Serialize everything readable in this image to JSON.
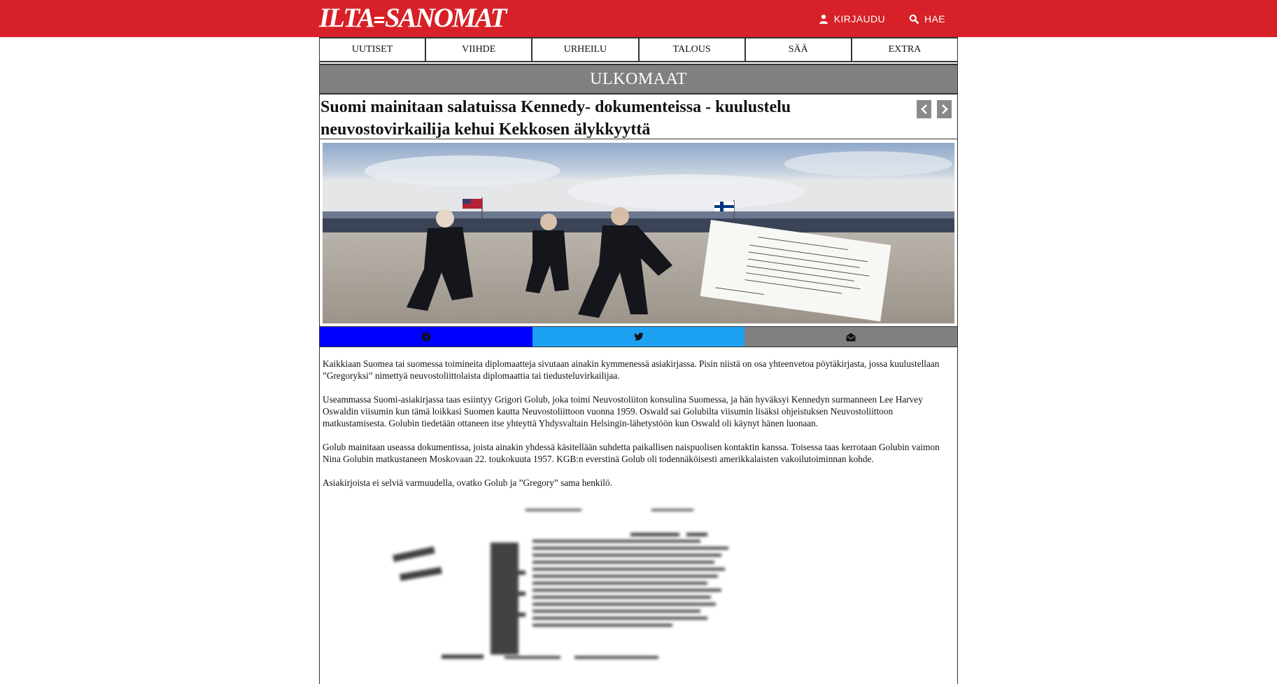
{
  "brand": {
    "logo_left": "ILTA",
    "logo_right": "SANOMAT",
    "accent": "#d72027"
  },
  "top_actions": {
    "login_label": "KIRJAUDU",
    "login_icon": "user-icon",
    "search_label": "HAE",
    "search_icon": "search-icon"
  },
  "nav": {
    "items": [
      "UUTISET",
      "VIIHDE",
      "URHEILU",
      "TALOUS",
      "SÄÄ",
      "EXTRA"
    ]
  },
  "section": {
    "title": "ULKOMAAT"
  },
  "article": {
    "headline": "Suomi mainitaan salatuissa Kennedy- dokumenteissa - kuulustelu neuvostovirkailija kehui Kekkosen älykkyyttä",
    "paragraphs": [
      "Kaikkiaan Suomea tai suomessa toimineita diplomaatteja sivutaan ainakin kymmenessä asiakirjassa. Pisin niistä on osa yhteenvetoa pöytäkirjasta, jossa kuulustellaan ”Gregoryksi” nimettyä neuvostoliittolaista diplomaattia tai tiedusteluvirkailijaa.",
      "Useammassa Suomi-asiakirjassa taas esiintyy Grigori Golub, joka toimi Neuvostoliiton konsulina Suomessa, ja hän hyväksyi Kennedyn surmanneen Lee Harvey Oswaldin viisumin kun tämä loikkasi Suomen kautta Neuvostoliittoon vuonna 1959. Oswald sai Golubilta viisumin lisäksi ohjeistuksen Neuvostoliittoon matkustamisesta. Golubin tiedetään ottaneen itse yhteyttä Yhdysvaltain Helsingin-lähetystöön kun Oswald oli käynyt hänen luonaan.",
      "Golub mainitaan useassa dokumentissa, joista ainakin yhdessä käsitellään suhdetta paikallisen naispuolisen kontaktin kanssa. Toisessa taas kerrotaan Golubin vaimon Nina Golubin matkustaneen Moskovaan 22. toukokuuta 1957. KGB:n everstinä Golub oli todennäköisesti amerikkalaisten vakoilutoiminnan kohde.",
      "Asiakirjoista ei selviä varmuudella, ovatko Golub ja ”Gregory” sama henkilö."
    ]
  },
  "share": {
    "facebook_icon": "facebook-icon",
    "twitter_icon": "twitter-icon",
    "email_icon": "envelope-icon",
    "facebook_color": "#0000ff",
    "twitter_color": "#1da1f2",
    "email_color": "#808080"
  }
}
